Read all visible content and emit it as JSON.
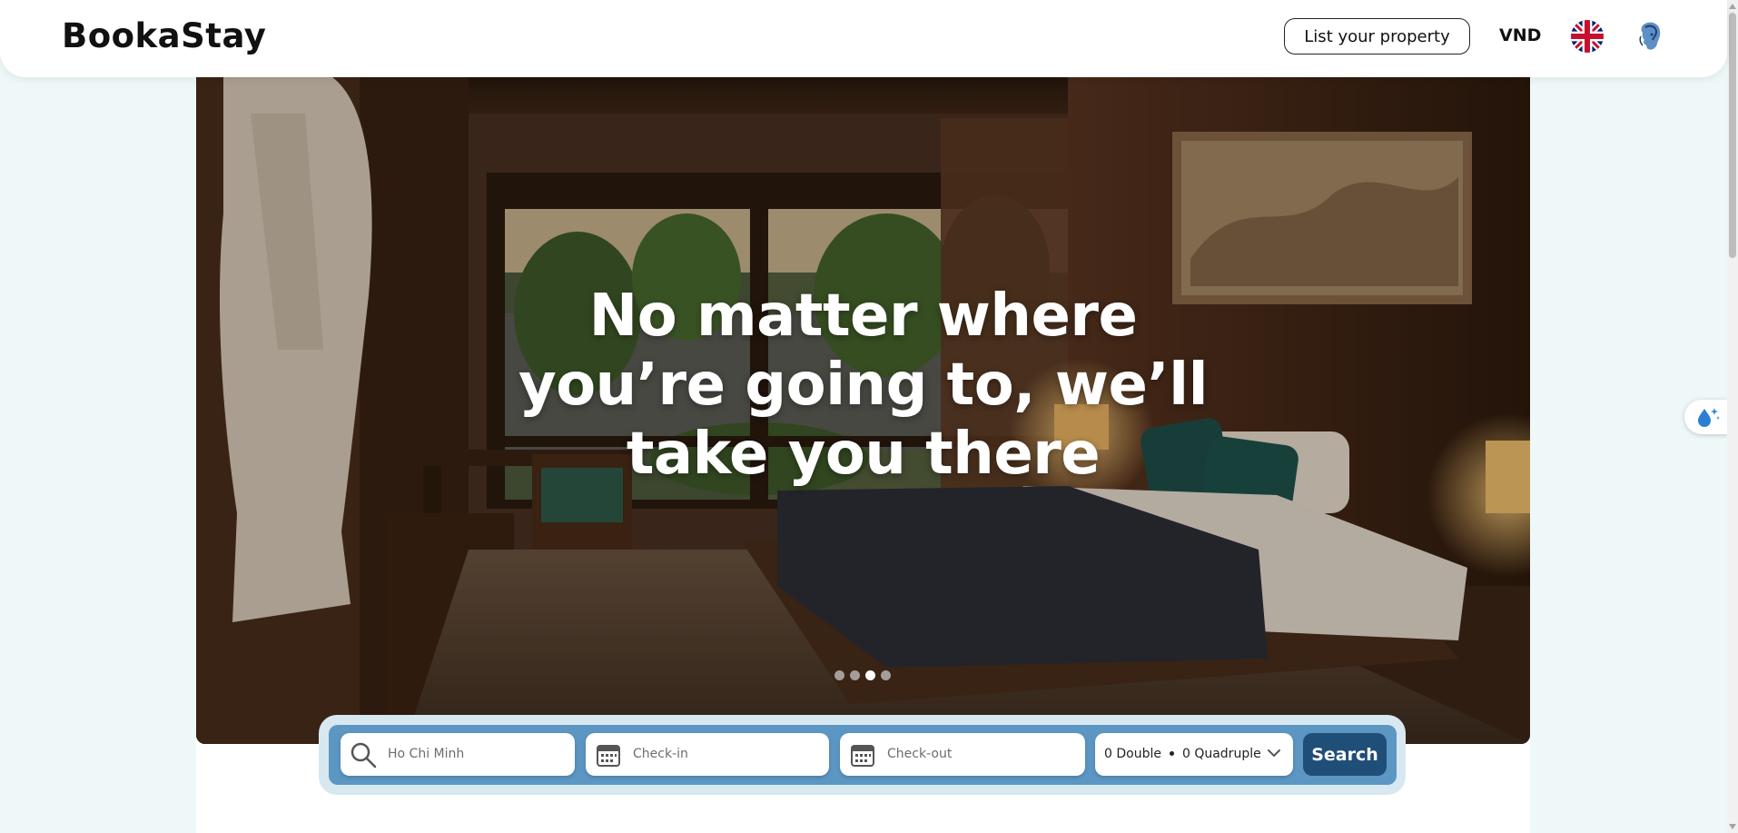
{
  "header": {
    "logo": "BookaStay",
    "list_property_label": "List your property",
    "currency": "VND",
    "language_icon": "uk-flag-icon",
    "avatar_icon": "user-avatar-icon"
  },
  "hero": {
    "title_lines": [
      "No matter where",
      "you’re going to, we’ll",
      "take you there"
    ],
    "carousel": {
      "slide_count": 4,
      "active_index": 2
    }
  },
  "search": {
    "destination": {
      "value": "Ho Chi Minh",
      "icon": "search-icon"
    },
    "check_in": {
      "placeholder": "Check-in",
      "icon": "calendar-icon"
    },
    "check_out": {
      "placeholder": "Check-out",
      "icon": "calendar-icon"
    },
    "guests": {
      "double": "0 Double",
      "quadruple": "0 Quadruple",
      "icon": "chevron-down-icon"
    },
    "button_label": "Search"
  },
  "colors": {
    "page_bg": "#eef8f9",
    "search_bar": "#5c97c4",
    "search_button": "#1f4e79"
  },
  "side_widget": {
    "icon": "water-drop-sparkle-icon"
  }
}
